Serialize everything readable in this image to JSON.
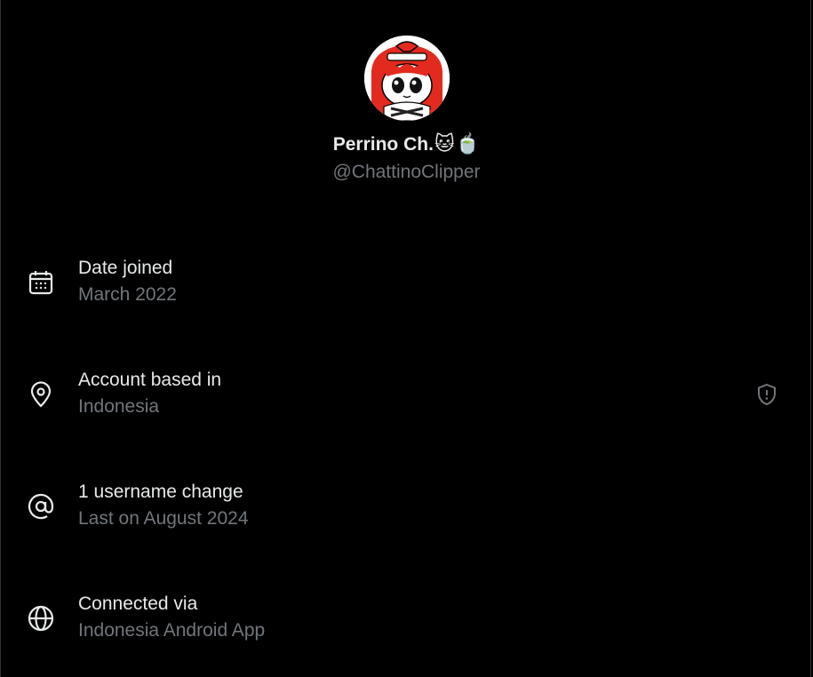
{
  "profile": {
    "display_name": "Perrino Ch.",
    "name_emojis": [
      "🐱",
      "🍵"
    ],
    "handle": "@ChattinoClipper"
  },
  "about": {
    "date_joined": {
      "label": "Date joined",
      "value": "March 2022",
      "icon": "calendar-icon"
    },
    "account_based_in": {
      "label": "Account based in",
      "value": "Indonesia",
      "icon": "location-pin-icon",
      "badge_icon": "shield-alert-icon"
    },
    "username_changes": {
      "label": "1 username change",
      "value": "Last on August 2024",
      "icon": "at-sign-icon"
    },
    "connected_via": {
      "label": "Connected via",
      "value": "Indonesia Android App",
      "icon": "globe-icon"
    }
  },
  "colors": {
    "background": "#000000",
    "primary_text": "#e7e9ea",
    "secondary_text": "#71767b",
    "avatar_accent": "#e32a1e"
  }
}
